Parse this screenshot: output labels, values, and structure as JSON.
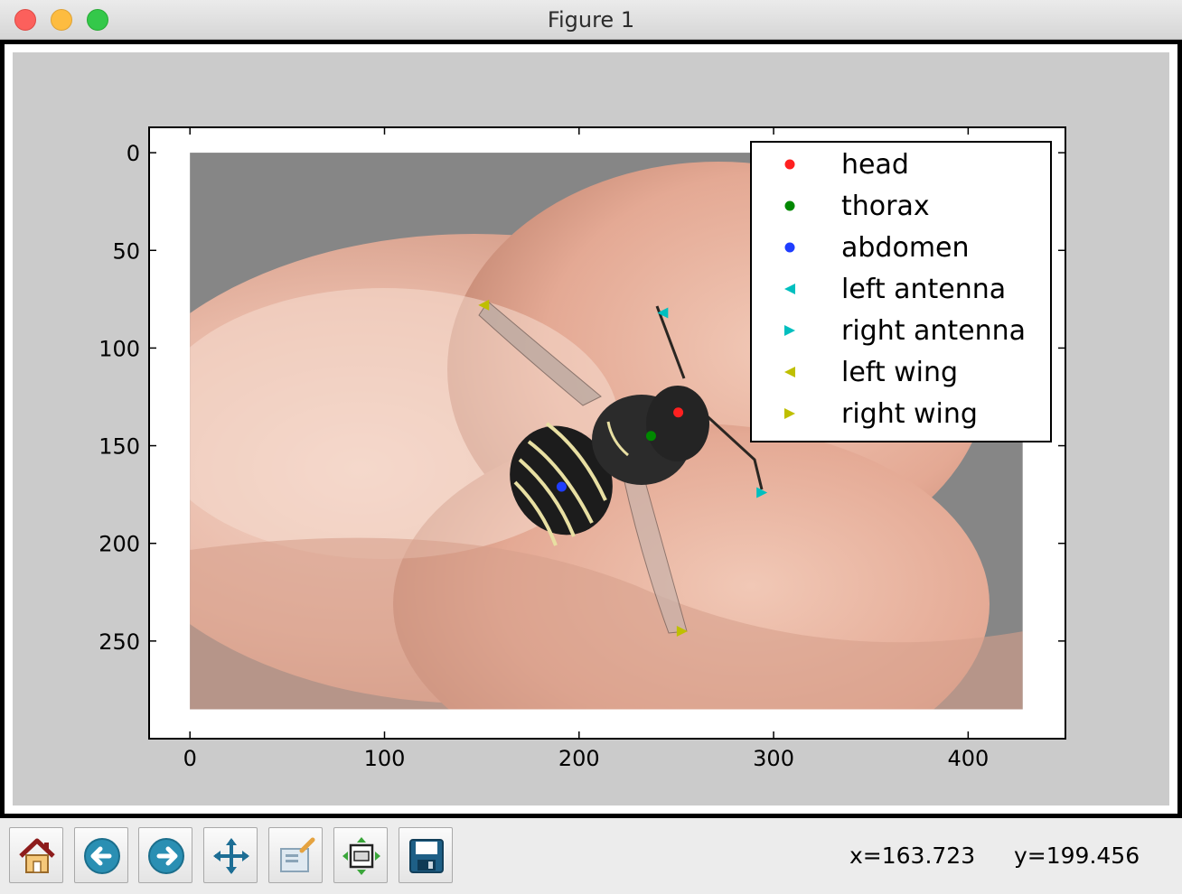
{
  "window": {
    "title": "Figure 1"
  },
  "chart_data": {
    "type": "scatter",
    "title": "",
    "xlabel": "",
    "ylabel": "",
    "xlim": [
      -21,
      450
    ],
    "ylim": [
      300,
      -13
    ],
    "y_inverted": true,
    "image_extent": {
      "x": [
        0,
        428
      ],
      "y": [
        0,
        285
      ]
    },
    "xticks": [
      0,
      100,
      200,
      300,
      400
    ],
    "yticks": [
      0,
      50,
      100,
      150,
      200,
      250
    ],
    "legend_position": "upper right",
    "series": [
      {
        "name": "head",
        "marker": "circle",
        "color": "#ff2020",
        "points": [
          [
            251,
            133
          ]
        ]
      },
      {
        "name": "thorax",
        "marker": "circle",
        "color": "#008800",
        "points": [
          [
            237,
            145
          ]
        ]
      },
      {
        "name": "abdomen",
        "marker": "circle",
        "color": "#1f3dff",
        "points": [
          [
            191,
            171
          ]
        ]
      },
      {
        "name": "left antenna",
        "marker": "triangle-left",
        "color": "#00bfbf",
        "points": [
          [
            243,
            82
          ]
        ]
      },
      {
        "name": "right antenna",
        "marker": "triangle-right",
        "color": "#00bfbf",
        "points": [
          [
            294,
            174
          ]
        ]
      },
      {
        "name": "left wing",
        "marker": "triangle-left",
        "color": "#bfbf00",
        "points": [
          [
            151,
            78
          ]
        ]
      },
      {
        "name": "right wing",
        "marker": "triangle-right",
        "color": "#bfbf00",
        "points": [
          [
            253,
            245
          ]
        ]
      }
    ]
  },
  "toolbar": {
    "buttons": [
      {
        "name": "home-button",
        "icon": "home-icon"
      },
      {
        "name": "back-button",
        "icon": "back-arrow-icon"
      },
      {
        "name": "forward-button",
        "icon": "forward-arrow-icon"
      },
      {
        "name": "pan-button",
        "icon": "move-icon"
      },
      {
        "name": "zoom-button",
        "icon": "zoom-rect-icon"
      },
      {
        "name": "subplots-button",
        "icon": "subplots-icon"
      },
      {
        "name": "save-button",
        "icon": "save-disk-icon"
      }
    ]
  },
  "status": {
    "x_readout": "x=163.723",
    "y_readout": "y=199.456"
  }
}
